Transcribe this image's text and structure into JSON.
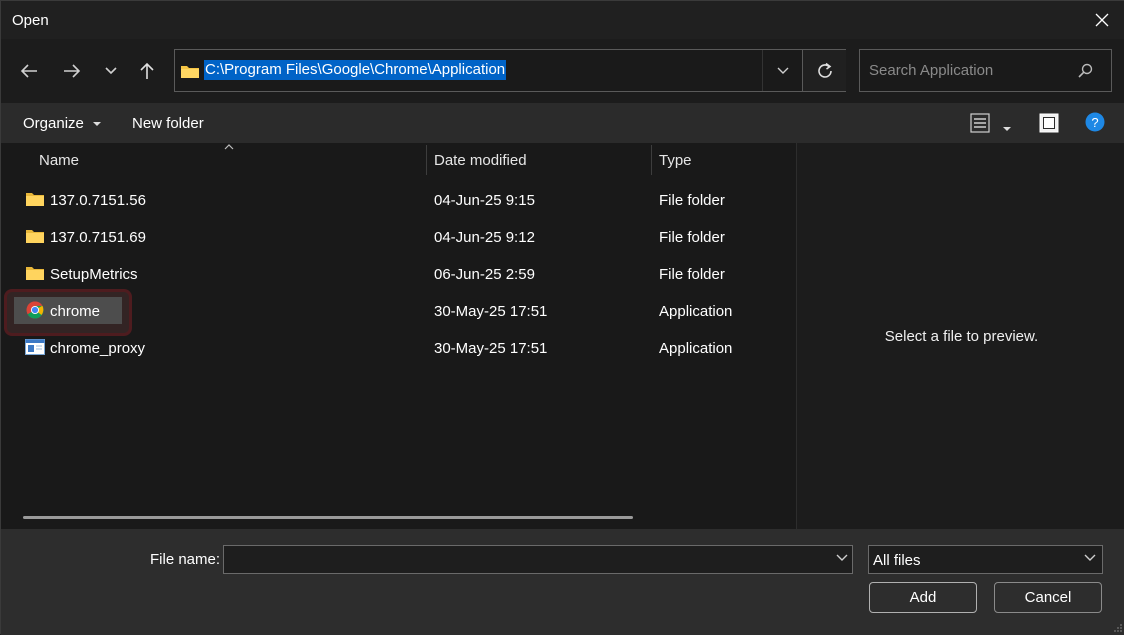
{
  "window": {
    "title": "Open"
  },
  "address": {
    "path": "C:\\Program Files\\Google\\Chrome\\Application"
  },
  "search": {
    "placeholder": "Search Application"
  },
  "toolbar": {
    "organize_label": "Organize",
    "new_folder_label": "New folder"
  },
  "columns": {
    "name": "Name",
    "date": "Date modified",
    "type": "Type"
  },
  "files": [
    {
      "name": "137.0.7151.56",
      "date": "04-Jun-25 9:15",
      "type": "File folder",
      "icon": "folder-icon"
    },
    {
      "name": "137.0.7151.69",
      "date": "04-Jun-25 9:12",
      "type": "File folder",
      "icon": "folder-icon"
    },
    {
      "name": "SetupMetrics",
      "date": "06-Jun-25 2:59",
      "type": "File folder",
      "icon": "folder-icon"
    },
    {
      "name": "chrome",
      "date": "30-May-25 17:51",
      "type": "Application",
      "icon": "chrome-icon",
      "selected": true
    },
    {
      "name": "chrome_proxy",
      "date": "30-May-25 17:51",
      "type": "Application",
      "icon": "application-icon"
    }
  ],
  "preview": {
    "message": "Select a file to preview."
  },
  "footer": {
    "file_name_label": "File name:",
    "file_name_value": "",
    "filter_value": "All files",
    "add_label": "Add",
    "cancel_label": "Cancel"
  },
  "colors": {
    "accent": "#0063c7",
    "selection_ring": "#7a1f24",
    "help_blue": "#1e88e5"
  }
}
